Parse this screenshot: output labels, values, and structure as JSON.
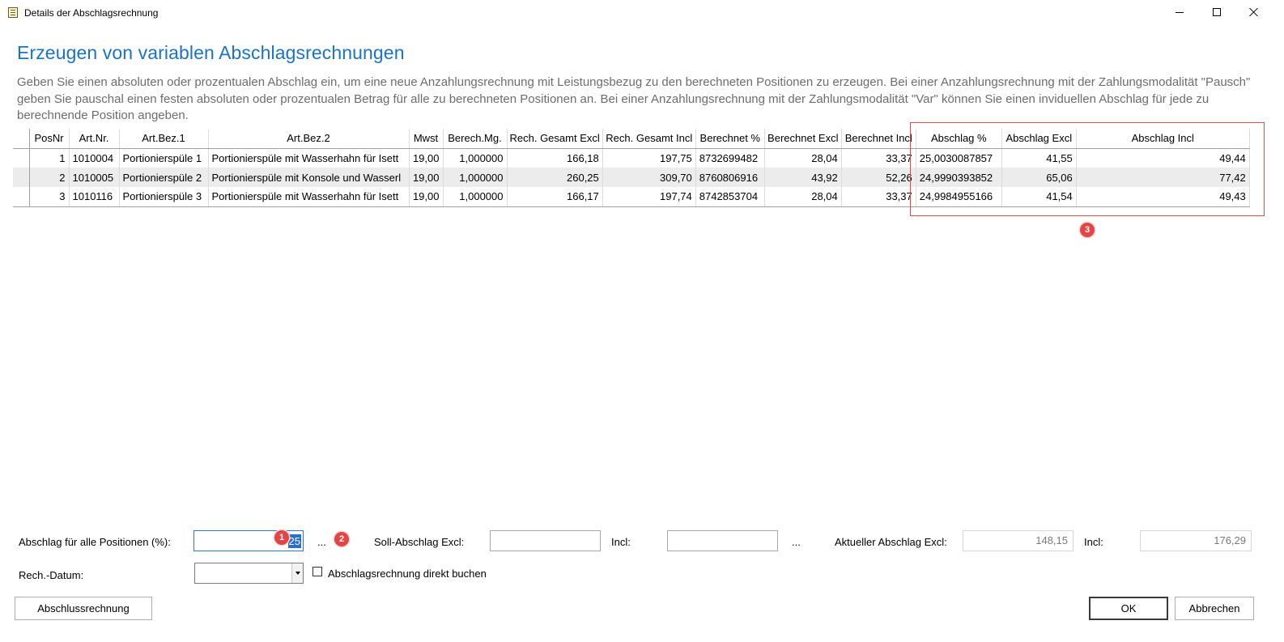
{
  "window": {
    "title": "Details der Abschlagsrechnung"
  },
  "heading": "Erzeugen von variablen Abschlagsrechnungen",
  "description": "Geben Sie einen absoluten oder prozentualen Abschlag ein, um eine neue Anzahlungsrechnung mit Leistungsbezug zu den berechneten Positionen zu erzeugen. Bei einer Anzahlungsrechnung mit der Zahlungsmodalität \"Pausch\" geben Sie pauschal einen festen absoluten oder prozentualen Betrag für alle zu berechneten Positionen an. Bei einer Anzahlungsrechnung mit der Zahlungsmodalität \"Var\" können Sie einen inviduellen Abschlag für jede zu berechnende Position angeben.",
  "grid": {
    "columns": [
      "PosNr",
      "Art.Nr.",
      "Art.Bez.1",
      "Art.Bez.2",
      "Mwst",
      "Berech.Mg.",
      "Rech. Gesamt Excl",
      "Rech. Gesamt Incl",
      "Berechnet %",
      "Berechnet Excl",
      "Berechnet Incl",
      "Abschlag %",
      "Abschlag Excl",
      "Abschlag Incl"
    ],
    "rows": [
      [
        "1",
        "1010004",
        "Portionierspüle 1",
        "Portionierspüle mit Wasserhahn für Isett",
        "19,00",
        "1,000000",
        "166,18",
        "197,75",
        "8732699482",
        "28,04",
        "33,37",
        "25,0030087857",
        "41,55",
        "49,44"
      ],
      [
        "2",
        "1010005",
        "Portionierspüle 2",
        "Portionierspüle mit Konsole und Wasserl",
        "19,00",
        "1,000000",
        "260,25",
        "309,70",
        "8760806916",
        "43,92",
        "52,26",
        "24,9990393852",
        "65,06",
        "77,42"
      ],
      [
        "3",
        "1010116",
        "Portionierspüle 3",
        "Portionierspüle mit Wasserhahn für Isett",
        "19,00",
        "1,000000",
        "166,17",
        "197,74",
        "8742853704",
        "28,04",
        "33,37",
        "24,9984955166",
        "41,54",
        "49,43"
      ]
    ]
  },
  "markers": {
    "m1": "1",
    "m2": "2",
    "m3": "3"
  },
  "form": {
    "abschlag_label": "Abschlag für alle Positionen (%):",
    "abschlag_value": "25",
    "ellipsis": "...",
    "soll_label": "Soll-Abschlag Excl:",
    "soll_excl_value": "",
    "incl_label": "Incl:",
    "soll_incl_value": "",
    "aktuell_label": "Aktueller Abschlag Excl:",
    "aktuell_excl_value": "148,15",
    "aktuell_incl_label": "Incl:",
    "aktuell_incl_value": "176,29",
    "datum_label": "Rech.-Datum:",
    "datum_value": "",
    "direkt_buchen_label": "Abschlagsrechnung direkt buchen",
    "direkt_buchen_checked": false
  },
  "buttons": {
    "schluss": "Abschlussrechnung",
    "ok": "OK",
    "cancel": "Abbrechen"
  },
  "colors": {
    "heading": "#1a73c8",
    "highlight": "#e04b4b",
    "selection": "#2a6fce"
  }
}
